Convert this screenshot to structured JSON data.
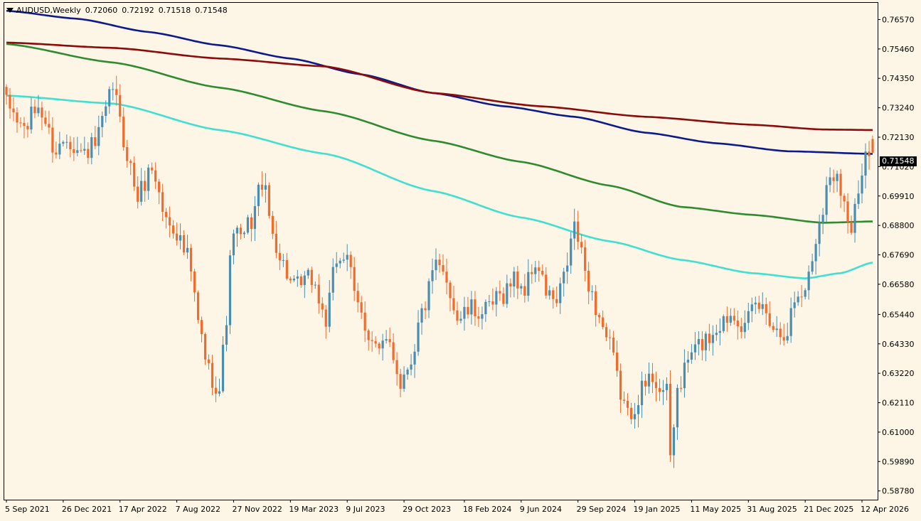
{
  "header": {
    "symbol": "AUDUSD,Weekly",
    "open": "0.72060",
    "high": "0.72192",
    "low": "0.71518",
    "close": "0.71548"
  },
  "current_price_label": "0.71548",
  "colors": {
    "background": "#fdf6e6",
    "bull_candle": "#4a8db3",
    "bear_candle": "#f26a2c",
    "ma_navy": "#0d1a8c",
    "ma_maroon": "#8b0a0a",
    "ma_green": "#2e8b2e",
    "ma_turquoise": "#40e0d0"
  },
  "chart_data": {
    "type": "candlestick",
    "y_ticks": [
      "0.76570",
      "0.75460",
      "0.74350",
      "0.73240",
      "0.72130",
      "0.71020",
      "0.69910",
      "0.68800",
      "0.67690",
      "0.66580",
      "0.65440",
      "0.64330",
      "0.63220",
      "0.62110",
      "0.61000",
      "0.59890",
      "0.58780"
    ],
    "ylim": [
      0.5845,
      0.772
    ],
    "x_ticks": [
      "5 Sep 2021",
      "26 Dec 2021",
      "17 Apr 2022",
      "7 Aug 2022",
      "27 Nov 2022",
      "19 Mar 2023",
      "9 Jul 2023",
      "29 Oct 2023",
      "18 Feb 2024",
      "9 Jun 2024",
      "29 Sep 2024",
      "19 Jan 2025",
      "11 May 2025",
      "31 Aug 2025",
      "21 Dec 2025",
      "12 Apr 2026"
    ],
    "candle_count": 245,
    "close_path_anchors": [
      [
        0,
        0.7335
      ],
      [
        5,
        0.7245
      ],
      [
        9,
        0.733
      ],
      [
        14,
        0.716
      ],
      [
        17,
        0.722
      ],
      [
        21,
        0.715
      ],
      [
        25,
        0.718
      ],
      [
        28,
        0.73
      ],
      [
        30,
        0.741
      ],
      [
        33,
        0.72
      ],
      [
        37,
        0.699
      ],
      [
        41,
        0.71
      ],
      [
        45,
        0.69
      ],
      [
        47,
        0.688
      ],
      [
        51,
        0.676
      ],
      [
        55,
        0.645
      ],
      [
        57,
        0.633
      ],
      [
        60,
        0.626
      ],
      [
        61,
        0.64
      ],
      [
        64,
        0.687
      ],
      [
        66,
        0.682
      ],
      [
        69,
        0.69
      ],
      [
        72,
        0.705
      ],
      [
        75,
        0.685
      ],
      [
        78,
        0.673
      ],
      [
        81,
        0.664
      ],
      [
        86,
        0.668
      ],
      [
        90,
        0.652
      ],
      [
        93,
        0.675
      ],
      [
        96,
        0.678
      ],
      [
        98,
        0.66
      ],
      [
        102,
        0.648
      ],
      [
        105,
        0.64
      ],
      [
        108,
        0.644
      ],
      [
        111,
        0.629
      ],
      [
        114,
        0.638
      ],
      [
        117,
        0.655
      ],
      [
        121,
        0.672
      ],
      [
        124,
        0.668
      ],
      [
        127,
        0.653
      ],
      [
        131,
        0.656
      ],
      [
        135,
        0.655
      ],
      [
        139,
        0.661
      ],
      [
        143,
        0.668
      ],
      [
        146,
        0.664
      ],
      [
        149,
        0.674
      ],
      [
        152,
        0.663
      ],
      [
        155,
        0.658
      ],
      [
        157,
        0.668
      ],
      [
        160,
        0.688
      ],
      [
        163,
        0.671
      ],
      [
        166,
        0.657
      ],
      [
        170,
        0.642
      ],
      [
        173,
        0.625
      ],
      [
        175,
        0.616
      ],
      [
        179,
        0.626
      ],
      [
        182,
        0.631
      ],
      [
        186,
        0.624
      ],
      [
        187,
        0.6
      ],
      [
        189,
        0.626
      ],
      [
        193,
        0.64
      ],
      [
        197,
        0.645
      ],
      [
        201,
        0.651
      ],
      [
        205,
        0.656
      ],
      [
        208,
        0.649
      ],
      [
        211,
        0.658
      ],
      [
        214,
        0.656
      ],
      [
        217,
        0.648
      ],
      [
        220,
        0.649
      ],
      [
        222,
        0.66
      ],
      [
        224,
        0.662
      ],
      [
        226,
        0.669
      ],
      [
        229,
        0.69
      ],
      [
        231,
        0.702
      ],
      [
        234,
        0.71
      ],
      [
        236,
        0.696
      ],
      [
        238,
        0.686
      ],
      [
        240,
        0.7
      ],
      [
        242,
        0.712
      ],
      [
        244,
        0.7155
      ]
    ],
    "moving_averages": [
      {
        "color_key": "ma_navy",
        "points": [
          [
            0,
            0.769
          ],
          [
            20,
            0.766
          ],
          [
            40,
            0.761
          ],
          [
            60,
            0.756
          ],
          [
            80,
            0.751
          ],
          [
            100,
            0.745
          ],
          [
            120,
            0.738
          ],
          [
            140,
            0.733
          ],
          [
            160,
            0.729
          ],
          [
            180,
            0.723
          ],
          [
            200,
            0.719
          ],
          [
            220,
            0.716
          ],
          [
            244,
            0.715
          ]
        ]
      },
      {
        "color_key": "ma_maroon",
        "points": [
          [
            0,
            0.757
          ],
          [
            30,
            0.755
          ],
          [
            60,
            0.751
          ],
          [
            90,
            0.748
          ],
          [
            120,
            0.738
          ],
          [
            150,
            0.733
          ],
          [
            180,
            0.729
          ],
          [
            210,
            0.726
          ],
          [
            230,
            0.7242
          ],
          [
            244,
            0.724
          ]
        ]
      },
      {
        "color_key": "ma_green",
        "points": [
          [
            0,
            0.7565
          ],
          [
            30,
            0.7495
          ],
          [
            60,
            0.74
          ],
          [
            90,
            0.731
          ],
          [
            120,
            0.72
          ],
          [
            145,
            0.712
          ],
          [
            170,
            0.703
          ],
          [
            190,
            0.695
          ],
          [
            210,
            0.692
          ],
          [
            230,
            0.689
          ],
          [
            244,
            0.6895
          ]
        ]
      },
      {
        "color_key": "ma_turquoise",
        "points": [
          [
            0,
            0.737
          ],
          [
            30,
            0.734
          ],
          [
            60,
            0.724
          ],
          [
            90,
            0.715
          ],
          [
            120,
            0.701
          ],
          [
            145,
            0.691
          ],
          [
            170,
            0.682
          ],
          [
            190,
            0.675
          ],
          [
            210,
            0.67
          ],
          [
            225,
            0.668
          ],
          [
            235,
            0.67
          ],
          [
            244,
            0.674
          ]
        ]
      }
    ]
  }
}
